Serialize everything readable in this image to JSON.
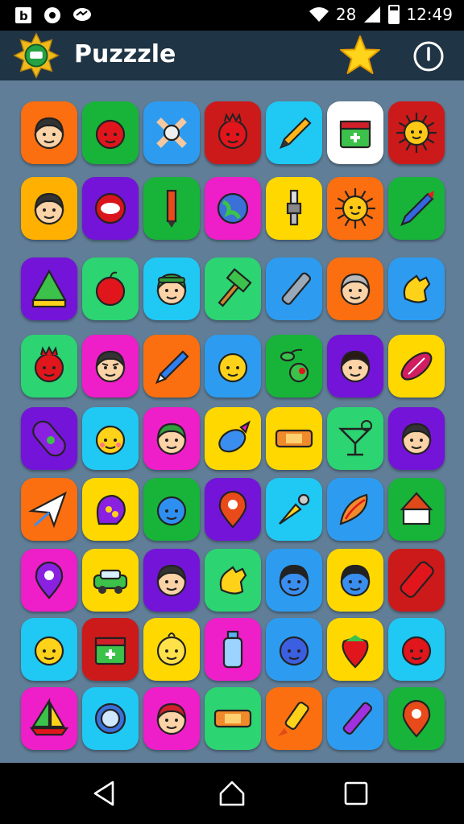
{
  "status_bar": {
    "left_icons": [
      "notification-b-icon",
      "record-icon",
      "messenger-icon"
    ],
    "right_icons": [
      "wifi-icon",
      "signal-icon"
    ],
    "network": "28",
    "time": "12:49"
  },
  "app_bar": {
    "title": "Puzzzle",
    "logo_icon": "gold-badge-logo-icon",
    "actions": [
      {
        "name": "star-button",
        "icon": "star-icon",
        "color": "#ffd41a"
      },
      {
        "name": "power-button",
        "icon": "power-icon"
      }
    ]
  },
  "colors": {
    "board": "#607e97",
    "app_bar": "#1f3444",
    "tile_palette": [
      "orange #fb6f10",
      "green #18b43a",
      "blue #2d9cf0",
      "red #cc1a1a",
      "cyan #20c8f4",
      "white #ffffff",
      "purple #7414d8",
      "magenta #ee1ec8",
      "yellow #ffd800",
      "lime #2cd472"
    ]
  },
  "board": {
    "rows": [
      [
        {
          "icon": "boy-face-icon",
          "color": "#fb6f10"
        },
        {
          "icon": "red-smiley-icon",
          "color": "#18b43a"
        },
        {
          "icon": "bone-cross-icon",
          "color": "#2d9cf0"
        },
        {
          "icon": "red-monster-icon",
          "color": "#cc1a1a"
        },
        {
          "icon": "pencil-icon",
          "color": "#20c8f4"
        },
        {
          "icon": "first-aid-box-icon",
          "color": "#ffffff"
        },
        {
          "icon": "sun-icon",
          "color": "#cc1a1a"
        }
      ],
      [
        {
          "icon": "boy-face-icon",
          "color": "#ffb000"
        },
        {
          "icon": "red-orb-icon",
          "color": "#7414d8"
        },
        {
          "icon": "pencil-vertical-icon",
          "color": "#18b43a"
        },
        {
          "icon": "planet-globe-icon",
          "color": "#ee1ec8"
        },
        {
          "icon": "spark-plug-icon",
          "color": "#ffd800"
        },
        {
          "icon": "sun-icon",
          "color": "#fb6f10"
        },
        {
          "icon": "blue-crayon-icon",
          "color": "#18b43a"
        }
      ],
      [
        {
          "icon": "tent-house-icon",
          "color": "#7414d8"
        },
        {
          "icon": "red-apple-icon",
          "color": "#2cd472"
        },
        {
          "icon": "cap-boy-icon",
          "color": "#20c8f4"
        },
        {
          "icon": "hammer-icon",
          "color": "#2cd472"
        },
        {
          "icon": "marker-pen-icon",
          "color": "#2d9cf0"
        },
        {
          "icon": "old-lady-face-icon",
          "color": "#fb6f10"
        },
        {
          "icon": "yellow-hand-icon",
          "color": "#2d9cf0"
        }
      ],
      [
        {
          "icon": "red-monster-icon",
          "color": "#2cd472"
        },
        {
          "icon": "angry-boy-icon",
          "color": "#ee1ec8"
        },
        {
          "icon": "blue-pencil-icon",
          "color": "#fb6f10"
        },
        {
          "icon": "smirk-face-icon",
          "color": "#2d9cf0"
        },
        {
          "icon": "cherry-icon",
          "color": "#18b43a"
        },
        {
          "icon": "girl-face-icon",
          "color": "#7414d8"
        },
        {
          "icon": "rugby-ball-icon",
          "color": "#ffd800"
        }
      ],
      [
        {
          "icon": "purple-capsule-icon",
          "color": "#7414d8"
        },
        {
          "icon": "blush-face-icon",
          "color": "#20c8f4"
        },
        {
          "icon": "green-hat-face-icon",
          "color": "#ee1ec8"
        },
        {
          "icon": "blue-fish-icon",
          "color": "#ffd800"
        },
        {
          "icon": "bandage-icon",
          "color": "#ffd800"
        },
        {
          "icon": "cocktail-icon",
          "color": "#2cd472"
        },
        {
          "icon": "boy-face-icon",
          "color": "#7414d8"
        }
      ],
      [
        {
          "icon": "paper-plane-icon",
          "color": "#fb6f10"
        },
        {
          "icon": "purple-bag-icon",
          "color": "#ffd800"
        },
        {
          "icon": "blue-blob-icon",
          "color": "#18b43a"
        },
        {
          "icon": "map-pin-icon",
          "color": "#7414d8"
        },
        {
          "icon": "gold-dagger-icon",
          "color": "#20c8f4"
        },
        {
          "icon": "shell-icon",
          "color": "#2d9cf0"
        },
        {
          "icon": "red-house-icon",
          "color": "#18b43a"
        }
      ],
      [
        {
          "icon": "purple-pin-icon",
          "color": "#ee1ec8"
        },
        {
          "icon": "green-car-icon",
          "color": "#ffd800"
        },
        {
          "icon": "boy-face-icon",
          "color": "#7414d8"
        },
        {
          "icon": "yellow-hand-icon",
          "color": "#2cd472"
        },
        {
          "icon": "blue-face-icon",
          "color": "#2d9cf0"
        },
        {
          "icon": "blue-face-icon",
          "color": "#ffd800"
        },
        {
          "icon": "red-lighter-icon",
          "color": "#cc1a1a"
        }
      ],
      [
        {
          "icon": "yellow-smiley-icon",
          "color": "#20c8f4"
        },
        {
          "icon": "first-aid-box-icon",
          "color": "#cc1a1a"
        },
        {
          "icon": "chick-face-icon",
          "color": "#ffd800"
        },
        {
          "icon": "bottle-icon",
          "color": "#ee1ec8"
        },
        {
          "icon": "blue-ball-icon",
          "color": "#2d9cf0"
        },
        {
          "icon": "strawberry-icon",
          "color": "#ffd800"
        },
        {
          "icon": "red-ball-icon",
          "color": "#20c8f4"
        }
      ],
      [
        {
          "icon": "sailboat-icon",
          "color": "#ee1ec8"
        },
        {
          "icon": "ring-icon",
          "color": "#20c8f4"
        },
        {
          "icon": "redhead-face-icon",
          "color": "#ee1ec8"
        },
        {
          "icon": "bandage-icon",
          "color": "#2cd472"
        },
        {
          "icon": "candle-rocket-icon",
          "color": "#fb6f10"
        },
        {
          "icon": "purple-marker-icon",
          "color": "#2d9cf0"
        },
        {
          "icon": "map-pin-icon",
          "color": "#18b43a"
        }
      ]
    ]
  },
  "nav_bar": {
    "buttons": [
      {
        "name": "back-button",
        "icon": "triangle-back-icon"
      },
      {
        "name": "home-button",
        "icon": "home-icon"
      },
      {
        "name": "recents-button",
        "icon": "square-recents-icon"
      }
    ]
  }
}
